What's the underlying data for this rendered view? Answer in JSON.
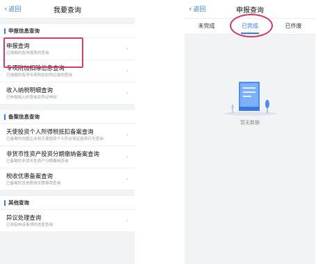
{
  "left": {
    "nav": {
      "back_label": "返回",
      "title": "我要查询"
    },
    "sections": [
      {
        "heading": "申报信息查询",
        "items": [
          {
            "title": "申报查询",
            "subtitle": "已填报的各项报表的查询"
          },
          {
            "title": "专项附加扣除信息查询",
            "subtitle": "已填报的各项专项附加扣除记录的查询"
          },
          {
            "title": "收入纳税明细查询",
            "subtitle": "已申报收入的查询及异议申诉"
          }
        ]
      },
      {
        "heading": "备案信息查询",
        "items": [
          {
            "title": "天使投资个人所得税抵扣备案查询",
            "subtitle": "已备案的创投企业和天使投资个人符合规定投资行为查询"
          },
          {
            "title": "非货币性资产投资分期缴纳备案查询",
            "subtitle": "已备案的非货币性资产分期缴纳查询"
          },
          {
            "title": "税收优惠备案查询",
            "subtitle": "已备案的其他税收优惠事项查询"
          }
        ]
      },
      {
        "heading": "其他查询",
        "items": [
          {
            "title": "异议处理查询",
            "subtitle": "已发起申诉事项的进度查询"
          }
        ]
      }
    ]
  },
  "right": {
    "nav": {
      "back_label": "返回",
      "title": "申报查询"
    },
    "tabs": [
      "未完成",
      "已完成",
      "已作废"
    ],
    "active_tab": "已完成",
    "empty_text": "暂无数据"
  },
  "colors": {
    "accent": "#2f7cf6",
    "highlight": "#d83a6c",
    "background": "#f2f3f5"
  }
}
